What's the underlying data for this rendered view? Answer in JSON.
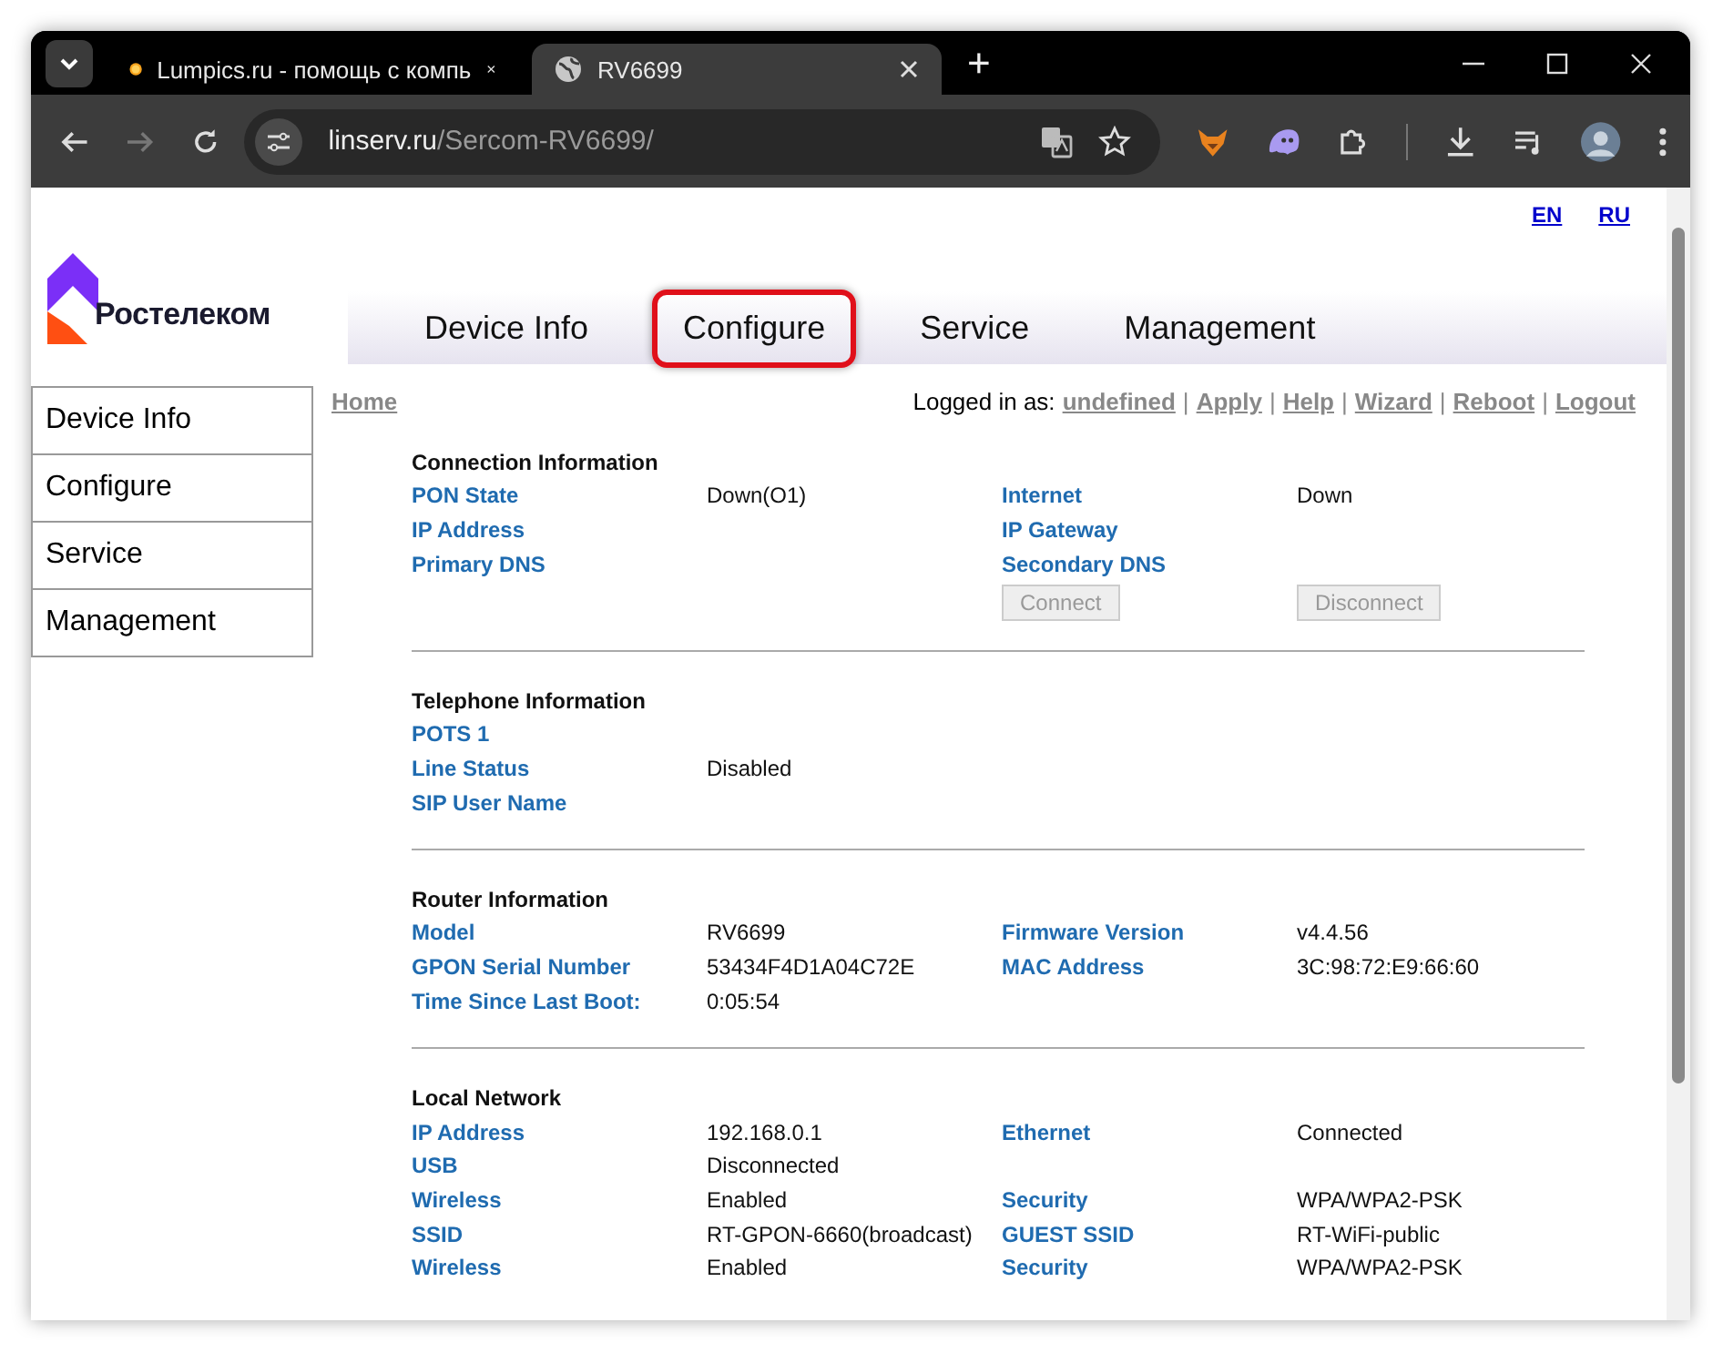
{
  "browser": {
    "tabs": [
      {
        "title": "Lumpics.ru - помощь с компь",
        "kind": "external",
        "selected": false
      },
      {
        "title": "RV6699",
        "kind": "local",
        "selected": true
      }
    ],
    "new_tab": "+",
    "url": {
      "host": "linserv.ru",
      "path": "/Sercom-RV6699/"
    }
  },
  "page": {
    "languages": [
      "EN",
      "RU"
    ],
    "logo": "Ростелеком",
    "top_nav": [
      {
        "label": "Device Info",
        "highlighted": false
      },
      {
        "label": "Configure",
        "highlighted": true
      },
      {
        "label": "Service",
        "highlighted": false
      },
      {
        "label": "Management",
        "highlighted": false
      }
    ],
    "side_nav": [
      "Device Info",
      "Configure",
      "Service",
      "Management"
    ],
    "breadcrumb": "Home",
    "logged_in_label": "Logged in as:",
    "header_links": [
      "undefined",
      "Apply",
      "Help",
      "Wizard",
      "Reboot",
      "Logout"
    ],
    "link_separator": "|",
    "sections": [
      {
        "title": "Connection Information",
        "rows": [
          {
            "label_1": "PON State",
            "value_1": "Down(O1)",
            "label_2": "Internet",
            "value_2": "Down"
          },
          {
            "label_1": "IP Address",
            "label_2": "IP Gateway"
          },
          {
            "label_1": "Primary DNS",
            "label_2": "Secondary DNS"
          }
        ],
        "buttons": [
          {
            "label": "Connect",
            "disabled": true
          },
          {
            "label": "Disconnect",
            "disabled": true
          }
        ]
      },
      {
        "title": "Telephone Information",
        "rows": [
          {
            "label_1": "POTS 1"
          },
          {
            "label_1": "Line Status",
            "value_1": "Disabled"
          },
          {
            "label_1": "SIP User Name"
          }
        ]
      },
      {
        "title": "Router Information",
        "rows": [
          {
            "label_1": "Model",
            "value_1": "RV6699",
            "label_2": "Firmware Version",
            "value_2": "v4.4.56"
          },
          {
            "label_1": "GPON Serial Number",
            "value_1": "53434F4D1A04C72E",
            "label_2": "MAC Address",
            "value_2": "3C:98:72:E9:66:60"
          },
          {
            "label_1": "Time Since Last Boot:",
            "value_1": "0:05:54"
          }
        ]
      },
      {
        "title": "Local Network",
        "rows": [
          {
            "label_1": "IP Address",
            "value_1": "192.168.0.1",
            "label_2": "Ethernet",
            "value_2": "Connected"
          },
          {
            "label_1": "USB",
            "value_1": "Disconnected"
          },
          {
            "label_1": "Wireless",
            "value_1": "Enabled",
            "label_2": "Security",
            "value_2": "WPA/WPA2-PSK"
          },
          {
            "label_1": "SSID",
            "value_1": "RT-GPON-6660(broadcast)",
            "label_2": "GUEST SSID",
            "value_2": "RT-WiFi-public"
          },
          {
            "label_1": "Wireless",
            "value_1": "Enabled",
            "label_2": "Security",
            "value_2": "WPA/WPA2-PSK"
          }
        ]
      }
    ]
  }
}
